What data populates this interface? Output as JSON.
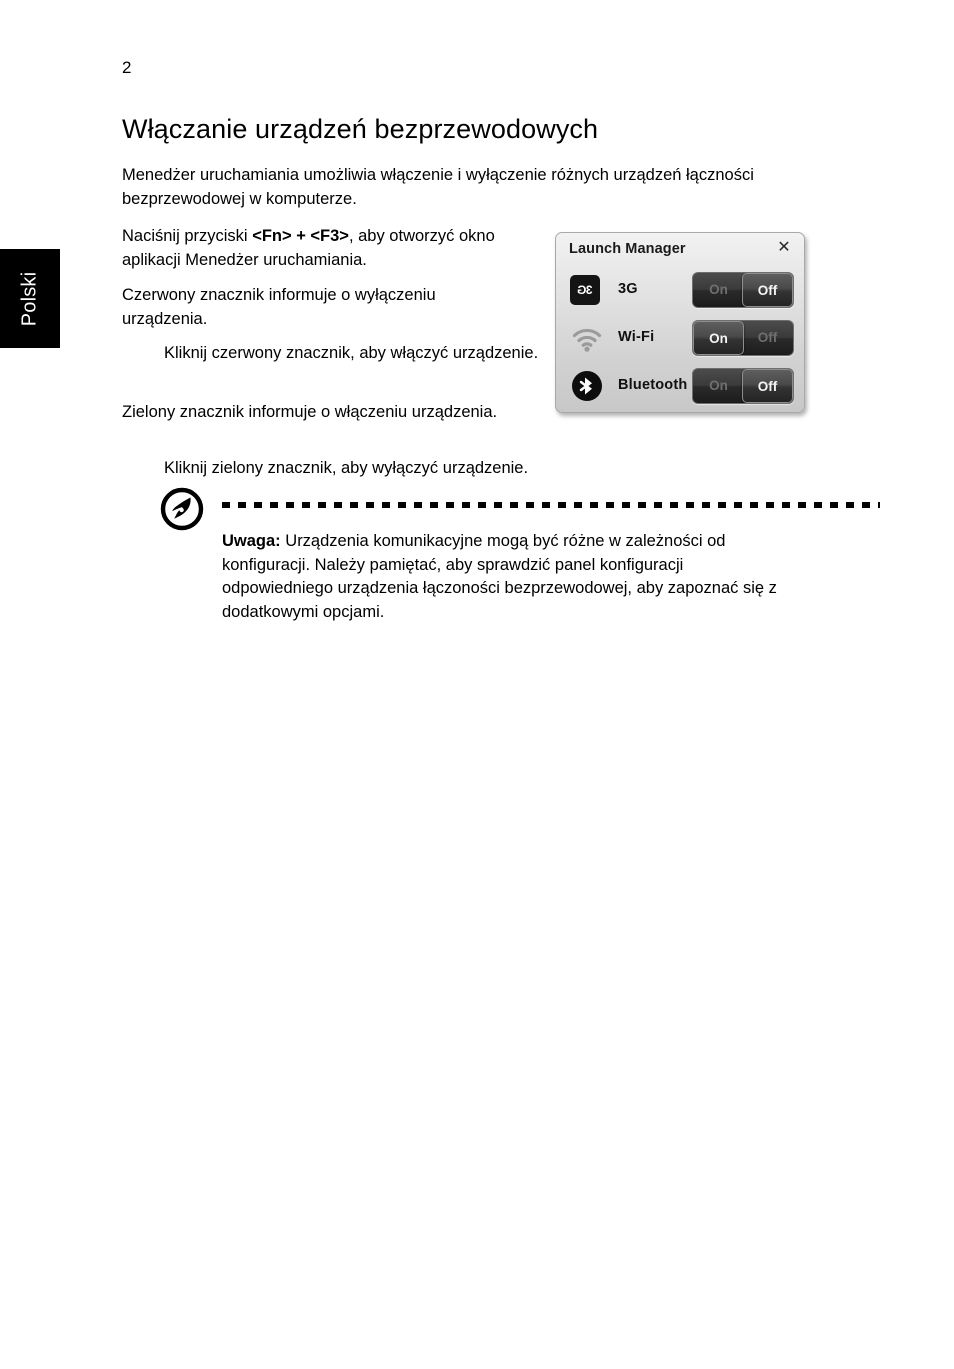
{
  "page": {
    "number": "2",
    "language_tab": "Polski",
    "title": "Włączanie urządzeń bezprzewodowych"
  },
  "body": {
    "intro": "Menedżer uruchamiania umożliwia włączenie i wyłączenie różnych urządzeń łączności bezprzewodowej w komputerze.",
    "fn_prefix": "Naciśnij przyciski ",
    "fn_keys": "<Fn> + <F3>",
    "fn_suffix": ", aby otworzyć okno aplikacji Menedżer uruchamiania.",
    "red_marker": "Czerwony znacznik informuje o wyłączeniu urządzenia.",
    "red_marker_sub": "Kliknij czerwony znacznik, aby włączyć urządzenie.",
    "green_marker": "Zielony znacznik informuje o włączeniu urządzenia.",
    "green_marker_sub": "Kliknij zielony znacznik, aby wyłączyć urządzenie."
  },
  "note": {
    "icon": "acer-logo-icon",
    "label": "Uwaga:",
    "text": " Urządzenia komunikacyjne mogą być różne w zależności od konfiguracji. Należy pamiętać, aby sprawdzić panel konfiguracji odpowiedniego urządzenia łączoności bezprzewodowej, aby zapoznać się z dodatkowymi opcjami."
  },
  "launch_manager": {
    "title": "Launch Manager",
    "close_glyph": "✕",
    "on_label": "On",
    "off_label": "Off",
    "rows": [
      {
        "icon": "3g-icon",
        "label": "3G",
        "state": "Off",
        "icon_text": "3G"
      },
      {
        "icon": "wifi-icon",
        "label": "Wi-Fi",
        "state": "On",
        "icon_text": ""
      },
      {
        "icon": "bluetooth-icon",
        "label": "Bluetooth",
        "state": "Off",
        "icon_text": ""
      }
    ]
  },
  "colors": {
    "page_background": "#ffffff",
    "text": "#000000",
    "tab_background": "#000000",
    "tab_text": "#ffffff",
    "dialog_background": "#e4e4e4",
    "toggle_track": "#2a2a2a",
    "toggle_active_text": "#f5f5f5",
    "toggle_inactive_text": "#6f6f6f"
  }
}
